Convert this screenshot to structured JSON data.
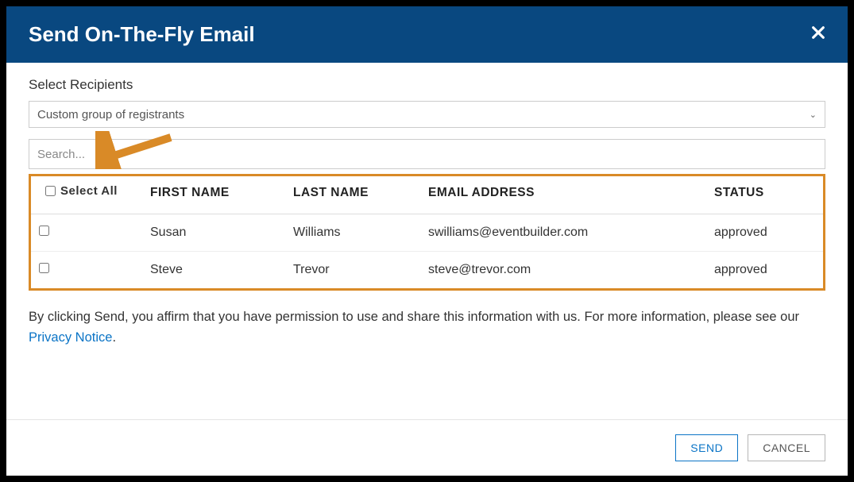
{
  "header": {
    "title": "Send On-The-Fly Email"
  },
  "body": {
    "select_label": "Select Recipients",
    "select_value": "Custom group of registrants",
    "search_placeholder": "Search...",
    "select_all_label": "Select All",
    "columns": {
      "first": "FIRST NAME",
      "last": "LAST NAME",
      "email": "EMAIL ADDRESS",
      "status": "STATUS"
    },
    "rows": [
      {
        "first": "Susan",
        "last": "Williams",
        "email": "swilliams@eventbuilder.com",
        "status": "approved"
      },
      {
        "first": "Steve",
        "last": "Trevor",
        "email": "steve@trevor.com",
        "status": "approved"
      }
    ],
    "disclaimer_prefix": "By clicking Send, you affirm that you have permission to use and share this information with us. For more information, please see our ",
    "privacy_link": "Privacy Notice",
    "disclaimer_suffix": "."
  },
  "footer": {
    "send": "SEND",
    "cancel": "CANCEL"
  }
}
